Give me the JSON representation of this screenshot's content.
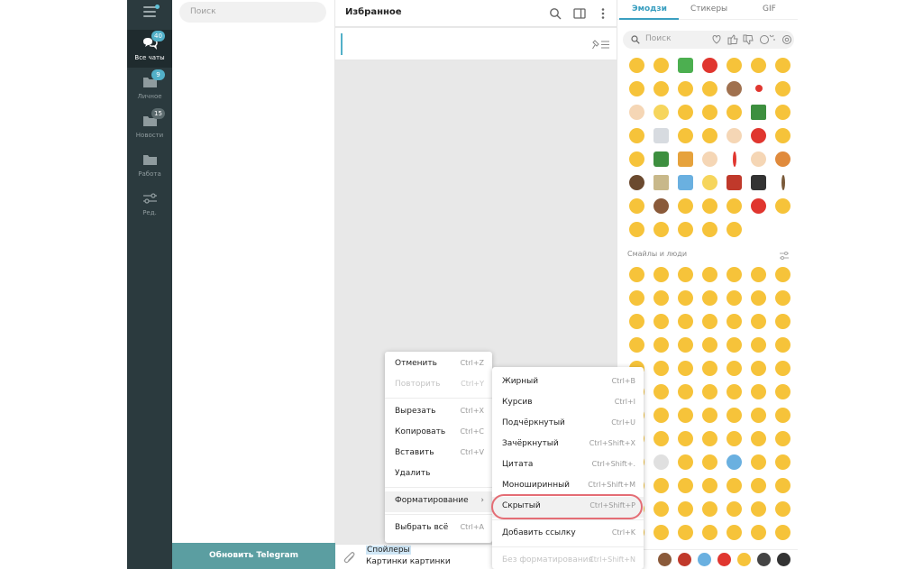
{
  "sidebar": {
    "folders": [
      {
        "label": "Все чаты",
        "badge": "40",
        "active": true,
        "icon": "chats-icon"
      },
      {
        "label": "Личное",
        "badge": "9",
        "active": false,
        "icon": "folder-icon"
      },
      {
        "label": "Новости",
        "badge": "15",
        "active": false,
        "icon": "folder-icon"
      },
      {
        "label": "Работа",
        "badge": "",
        "active": false,
        "icon": "folder-icon"
      },
      {
        "label": "Ред.",
        "badge": "",
        "active": false,
        "icon": "sliders-icon"
      }
    ]
  },
  "chatlist": {
    "search_placeholder": "Поиск",
    "update_button": "Обновить Telegram"
  },
  "chat": {
    "title": "Избранное",
    "input_line1": "Спойлеры",
    "input_line2": "Картинки картинки"
  },
  "emoji_panel": {
    "tabs": [
      "Эмодзи",
      "Стикеры",
      "GIF"
    ],
    "search_placeholder": "Поиск",
    "section_label": "Смайлы и люди",
    "colors": {
      "face": "#f6c33a",
      "red": "#e0362f",
      "green": "#4caf50",
      "skin": "#f5d6b5",
      "blue": "#6ab0e0"
    }
  },
  "context_menu": {
    "items": [
      {
        "label": "Отменить",
        "shortcut": "Ctrl+Z",
        "disabled": false
      },
      {
        "label": "Повторить",
        "shortcut": "Ctrl+Y",
        "disabled": true
      },
      {
        "label": "Вырезать",
        "shortcut": "Ctrl+X",
        "disabled": false
      },
      {
        "label": "Копировать",
        "shortcut": "Ctrl+C",
        "disabled": false
      },
      {
        "label": "Вставить",
        "shortcut": "Ctrl+V",
        "disabled": false
      },
      {
        "label": "Удалить",
        "shortcut": "",
        "disabled": false
      },
      {
        "label": "Форматирование",
        "shortcut": "",
        "disabled": false
      },
      {
        "label": "Выбрать всё",
        "shortcut": "Ctrl+A",
        "disabled": false
      }
    ]
  },
  "format_menu": {
    "items": [
      {
        "label": "Жирный",
        "shortcut": "Ctrl+B",
        "disabled": false
      },
      {
        "label": "Курсив",
        "shortcut": "Ctrl+I",
        "disabled": false
      },
      {
        "label": "Подчёркнутый",
        "shortcut": "Ctrl+U",
        "disabled": false
      },
      {
        "label": "Зачёркнутый",
        "shortcut": "Ctrl+Shift+X",
        "disabled": false
      },
      {
        "label": "Цитата",
        "shortcut": "Ctrl+Shift+.",
        "disabled": false
      },
      {
        "label": "Моноширинный",
        "shortcut": "Ctrl+Shift+M",
        "disabled": false
      },
      {
        "label": "Скрытый",
        "shortcut": "Ctrl+Shift+P",
        "disabled": false
      },
      {
        "label": "Добавить ссылку",
        "shortcut": "Ctrl+K",
        "disabled": false
      },
      {
        "label": "Без форматирования",
        "shortcut": "Ctrl+Shift+N",
        "disabled": true
      }
    ]
  }
}
